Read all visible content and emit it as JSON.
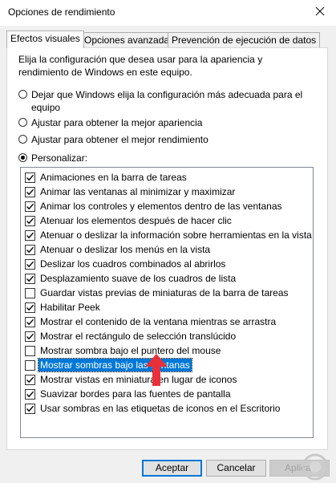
{
  "window": {
    "title": "Opciones de rendimiento"
  },
  "tabs": [
    {
      "label": "Efectos visuales",
      "active": true
    },
    {
      "label": "Opciones avanzadas",
      "active": false
    },
    {
      "label": "Prevención de ejecución de datos",
      "active": false
    }
  ],
  "intro": "Elija la configuración que desea usar para la apariencia y rendimiento de Windows en este equipo.",
  "radios": [
    {
      "label": "Dejar que Windows elija la configuración más adecuada para el equipo",
      "checked": false
    },
    {
      "label": "Ajustar para obtener la mejor apariencia",
      "checked": false
    },
    {
      "label": "Ajustar para obtener el mejor rendimiento",
      "checked": false
    },
    {
      "label": "Personalizar:",
      "checked": true
    }
  ],
  "effects": [
    {
      "label": "Animaciones en la barra de tareas",
      "checked": true
    },
    {
      "label": "Animar las ventanas al minimizar y maximizar",
      "checked": true
    },
    {
      "label": "Animar los controles y elementos dentro de las ventanas",
      "checked": true
    },
    {
      "label": "Atenuar los elementos después de hacer clic",
      "checked": true
    },
    {
      "label": "Atenuar o deslizar la información sobre herramientas en la vista",
      "checked": true
    },
    {
      "label": "Atenuar o deslizar los menús en la vista",
      "checked": true
    },
    {
      "label": "Deslizar los cuadros combinados al abrirlos",
      "checked": true
    },
    {
      "label": "Desplazamiento suave de los cuadros de lista",
      "checked": true
    },
    {
      "label": "Guardar vistas previas de miniaturas de la barra de tareas",
      "checked": false
    },
    {
      "label": "Habilitar Peek",
      "checked": true
    },
    {
      "label": "Mostrar el contenido de la ventana mientras se arrastra",
      "checked": true
    },
    {
      "label": "Mostrar el rectángulo de selección translúcido",
      "checked": true
    },
    {
      "label": "Mostrar sombra bajo el puntero del mouse",
      "checked": false
    },
    {
      "label": "Mostrar sombras bajo las ventanas",
      "checked": false,
      "selected": true
    },
    {
      "label": "Mostrar vistas en miniatura en lugar de iconos",
      "checked": true
    },
    {
      "label": "Suavizar bordes para las fuentes de pantalla",
      "checked": true
    },
    {
      "label": "Usar sombras en las etiquetas de iconos en el Escritorio",
      "checked": true
    }
  ],
  "buttons": {
    "accept": "Aceptar",
    "cancel": "Cancelar",
    "apply": "Aplicar"
  },
  "colors": {
    "selection": "#0078d7",
    "arrow": "#e8303a"
  },
  "icons": {
    "close": "close-icon",
    "arrow": "red-arrow-annotation-icon"
  }
}
